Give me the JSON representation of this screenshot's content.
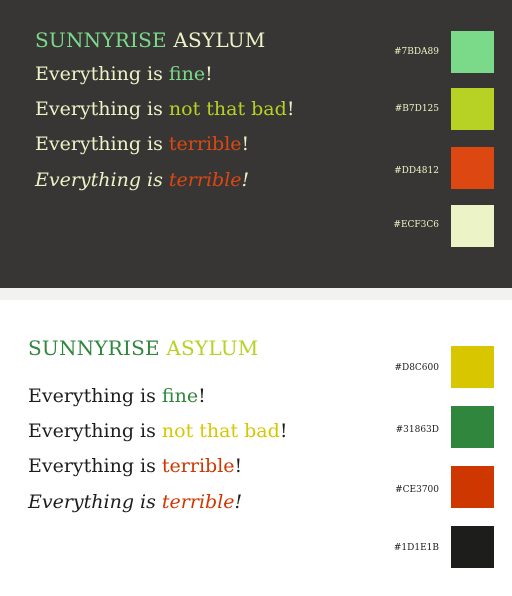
{
  "top": {
    "title": {
      "part1": "SUNNYRISE",
      "part2": "ASYLUM"
    },
    "lines": [
      {
        "prefix": "Everything is ",
        "emph": "fine",
        "suffix": "!"
      },
      {
        "prefix": "Everything is ",
        "emph": "not that bad",
        "suffix": "!"
      },
      {
        "prefix": "Everything is ",
        "emph": "terrible",
        "suffix": "!"
      },
      {
        "prefix": "Everything is ",
        "emph": "terrible",
        "suffix": "!"
      }
    ],
    "swatches": [
      {
        "hex": "#7BDA89",
        "color": "#7BDA89"
      },
      {
        "hex": "#B7D125",
        "color": "#B7D125"
      },
      {
        "hex": "#DD4812",
        "color": "#DD4812"
      },
      {
        "hex": "#ECF3C6",
        "color": "#ECF3C6"
      }
    ]
  },
  "bottom": {
    "title": {
      "part1": "SUNNYRISE",
      "part2": "ASYLUM"
    },
    "lines": [
      {
        "prefix": "Everything is ",
        "emph": "fine",
        "suffix": "!"
      },
      {
        "prefix": "Everything is ",
        "emph": "not that bad",
        "suffix": "!"
      },
      {
        "prefix": "Everything is ",
        "emph": "terrible",
        "suffix": "!"
      },
      {
        "prefix": "Everything is ",
        "emph": "terrible",
        "suffix": "!"
      }
    ],
    "swatches": [
      {
        "hex": "#D8C600",
        "color": "#D8C600"
      },
      {
        "hex": "#31863D",
        "color": "#31863D"
      },
      {
        "hex": "#CE3700",
        "color": "#CE3700"
      },
      {
        "hex": "#1D1E1B",
        "color": "#1D1E1B"
      }
    ]
  }
}
